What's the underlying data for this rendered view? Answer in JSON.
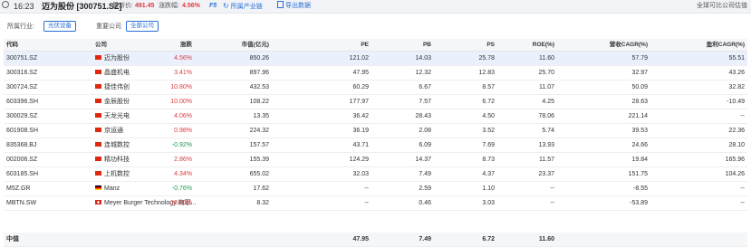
{
  "topbar": {
    "time": "16:23",
    "title": "迈为股份 [300751.SZ]",
    "price_label": "最新价:",
    "price_value": "491.45",
    "change_label": "涨跌幅:",
    "change_value": "4.56%",
    "f5": "F5",
    "chain_label": "所属产业链",
    "export_label": "导出数据",
    "right_link": "全球可比公司估值"
  },
  "filters": {
    "industry_label": "所属行业:",
    "industry_tag": "光伏设备",
    "company_label": "重要公司",
    "all_tag": "全部公司"
  },
  "columns": {
    "code": "代码",
    "name": "公司",
    "chg": "涨跌",
    "cap": "市值(亿元)",
    "pe": "PE",
    "pb": "PB",
    "ps": "PS",
    "roe": "ROE(%)",
    "rev_cagr": "营收CAGR(%)",
    "profit_cagr": "盈利CAGR(%)"
  },
  "rows": [
    {
      "code": "300751.SZ",
      "flag": "cn",
      "name": "迈为股份",
      "chg": "4.56%",
      "dir": "up",
      "cap": "850.26",
      "pe": "121.02",
      "pb": "14.03",
      "ps": "25.78",
      "roe": "11.60",
      "rev_cagr": "57.79",
      "profit_cagr": "55.51"
    },
    {
      "code": "300316.SZ",
      "flag": "cn",
      "name": "晶盛机电",
      "chg": "3.41%",
      "dir": "up",
      "cap": "897.96",
      "pe": "47.95",
      "pb": "12.32",
      "ps": "12.83",
      "roe": "25.70",
      "rev_cagr": "32.97",
      "profit_cagr": "43.26"
    },
    {
      "code": "300724.SZ",
      "flag": "cn",
      "name": "捷佳伟创",
      "chg": "10.80%",
      "dir": "up",
      "cap": "432.53",
      "pe": "60.29",
      "pb": "6.67",
      "ps": "8.57",
      "roe": "11.07",
      "rev_cagr": "50.09",
      "profit_cagr": "32.82"
    },
    {
      "code": "603396.SH",
      "flag": "cn",
      "name": "金辰股份",
      "chg": "10.00%",
      "dir": "up",
      "cap": "108.22",
      "pe": "177.97",
      "pb": "7.57",
      "ps": "6.72",
      "roe": "4.25",
      "rev_cagr": "28.63",
      "profit_cagr": "-10.49"
    },
    {
      "code": "300029.SZ",
      "flag": "cn",
      "name": "天龙光电",
      "chg": "4.06%",
      "dir": "up",
      "cap": "13.35",
      "pe": "36.42",
      "pb": "28.43",
      "ps": "4.50",
      "roe": "78.06",
      "rev_cagr": "221.14",
      "profit_cagr": "--"
    },
    {
      "code": "601908.SH",
      "flag": "cn",
      "name": "京运通",
      "chg": "0.98%",
      "dir": "up",
      "cap": "224.32",
      "pe": "36.19",
      "pb": "2.08",
      "ps": "3.52",
      "roe": "5.74",
      "rev_cagr": "39.53",
      "profit_cagr": "22.36"
    },
    {
      "code": "835368.BJ",
      "flag": "cn",
      "name": "连城数控",
      "chg": "-0.92%",
      "dir": "dn",
      "cap": "157.57",
      "pe": "43.71",
      "pb": "6.09",
      "ps": "7.69",
      "roe": "13.93",
      "rev_cagr": "24.66",
      "profit_cagr": "28.10"
    },
    {
      "code": "002006.SZ",
      "flag": "cn",
      "name": "精功科技",
      "chg": "2.86%",
      "dir": "up",
      "cap": "155.39",
      "pe": "124.29",
      "pb": "14.37",
      "ps": "8.73",
      "roe": "11.57",
      "rev_cagr": "19.84",
      "profit_cagr": "165.96"
    },
    {
      "code": "603185.SH",
      "flag": "cn",
      "name": "上机数控",
      "chg": "4.34%",
      "dir": "up",
      "cap": "655.02",
      "pe": "32.03",
      "pb": "7.49",
      "ps": "4.37",
      "roe": "23.37",
      "rev_cagr": "151.75",
      "profit_cagr": "104.26"
    },
    {
      "code": "M5Z.GR",
      "flag": "de",
      "name": "Manz",
      "chg": "-0.76%",
      "dir": "dn",
      "cap": "17.62",
      "pe": "--",
      "pb": "2.59",
      "ps": "1.10",
      "roe": "--",
      "rev_cagr": "-8.55",
      "profit_cagr": "--"
    },
    {
      "code": "MBTN.SW",
      "flag": "ch",
      "name": "Meyer Burger Technology 梅耶...",
      "chg": "10.00%",
      "dir": "up",
      "cap": "8.32",
      "pe": "--",
      "pb": "0.46",
      "ps": "3.03",
      "roe": "--",
      "rev_cagr": "-53.89",
      "profit_cagr": "--"
    }
  ],
  "median": {
    "label": "中值",
    "pe": "47.95",
    "pb": "7.49",
    "ps": "6.72",
    "roe": "11.60"
  },
  "colors": {
    "up": "#e0393e",
    "down": "#1e9b52",
    "accent": "#2a6fd6",
    "selected_row": "#eaf1fd"
  }
}
